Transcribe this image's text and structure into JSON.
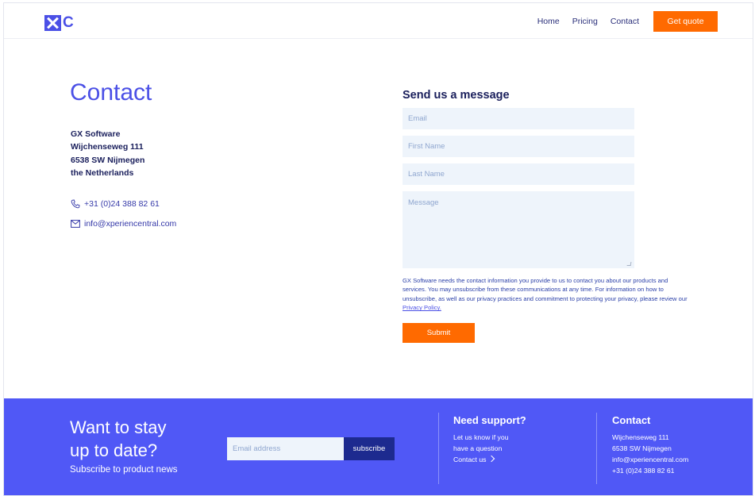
{
  "brand": {
    "logo_text": "C",
    "accent": "#4b50e6",
    "cta_color": "#ff6a00",
    "footer_color": "#5058f6"
  },
  "nav": {
    "items": [
      "Home",
      "Pricing",
      "Contact"
    ],
    "cta_label": "Get quote"
  },
  "contact": {
    "title": "Contact",
    "address": [
      "GX Software",
      "Wijchenseweg 111",
      "6538 SW Nijmegen",
      "the Netherlands"
    ],
    "phone": "+31 (0)24 388 82 61",
    "email": "info@xperiencentral.com",
    "phone_icon": "phone-icon",
    "email_icon": "envelope-icon"
  },
  "form": {
    "title": "Send us a message",
    "email_placeholder": "Email",
    "first_name_placeholder": "First Name",
    "last_name_placeholder": "Last Name",
    "message_placeholder": "Message",
    "privacy_text": "GX Software needs the contact information you provide to us to contact you about our products and services. You may unsubscribe from these communications at any time. For information on how to unsubscribe, as well as our privacy practices and commitment to protecting your privacy, please review our ",
    "privacy_link": "Privacy Policy.",
    "submit_label": "Submit"
  },
  "footer": {
    "headline_1": "Want to stay",
    "headline_2": "up to date?",
    "subline": "Subscribe to product news",
    "email_placeholder": "Email address",
    "subscribe_label": "subscribe",
    "support": {
      "title": "Need support?",
      "line_1": "Let us know if you",
      "line_2": "have a question",
      "link": "Contact us"
    },
    "contact": {
      "title": "Contact",
      "line_1": "Wijchenseweg 111",
      "line_2": "6538 SW Nijmegen",
      "line_3": "info@xperiencentral.com",
      "line_4": "+31 (0)24 388 82 61"
    }
  }
}
